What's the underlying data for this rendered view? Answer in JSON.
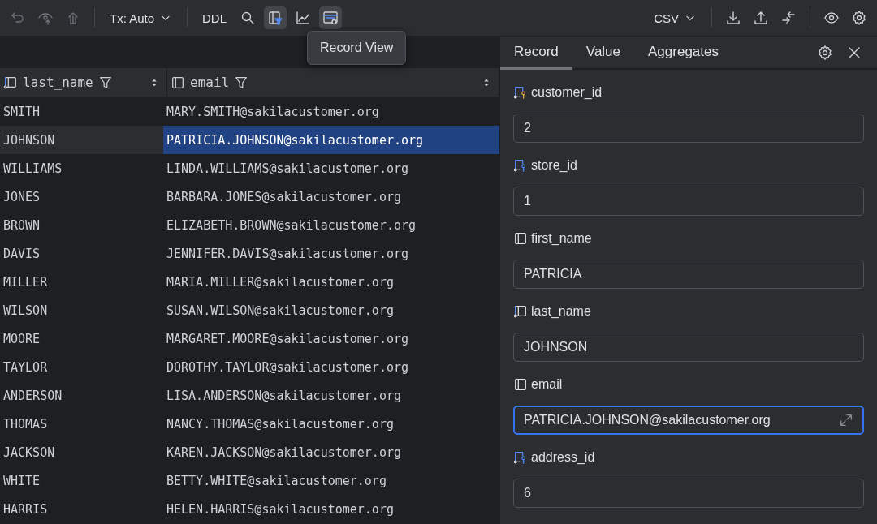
{
  "toolbar": {
    "left": [
      {
        "kind": "undo",
        "disabled": true,
        "toggled": false
      },
      {
        "kind": "eye-up",
        "disabled": true,
        "toggled": false
      },
      {
        "kind": "up",
        "disabled": true,
        "toggled": false
      },
      {
        "kind": "sep"
      },
      {
        "kind": "dropdown",
        "label": "Tx: Auto"
      },
      {
        "kind": "sep"
      },
      {
        "kind": "text",
        "label": "DDL"
      },
      {
        "kind": "search",
        "disabled": false,
        "toggled": false
      },
      {
        "kind": "filter",
        "disabled": false,
        "toggled": true
      },
      {
        "kind": "chart",
        "disabled": false,
        "toggled": false
      },
      {
        "kind": "record",
        "disabled": false,
        "toggled": true
      }
    ],
    "right": [
      {
        "kind": "dropdown",
        "label": "CSV"
      },
      {
        "kind": "sep"
      },
      {
        "kind": "download",
        "disabled": false,
        "toggled": false
      },
      {
        "kind": "upload",
        "disabled": false,
        "toggled": false
      },
      {
        "kind": "compare",
        "disabled": false,
        "toggled": false
      },
      {
        "kind": "sep"
      },
      {
        "kind": "eye",
        "disabled": false,
        "toggled": false
      },
      {
        "kind": "gear",
        "disabled": false,
        "toggled": false
      }
    ],
    "tooltip": "Record View"
  },
  "table": {
    "columns": [
      {
        "name": "last_name",
        "kind": "indexed"
      },
      {
        "name": "email",
        "kind": "column"
      }
    ],
    "rows": [
      {
        "cells": [
          "SMITH",
          "MARY.SMITH@sakilacustomer.org"
        ],
        "selected": false
      },
      {
        "cells": [
          "JOHNSON",
          "PATRICIA.JOHNSON@sakilacustomer.org"
        ],
        "selected": true
      },
      {
        "cells": [
          "WILLIAMS",
          "LINDA.WILLIAMS@sakilacustomer.org"
        ],
        "selected": false
      },
      {
        "cells": [
          "JONES",
          "BARBARA.JONES@sakilacustomer.org"
        ],
        "selected": false
      },
      {
        "cells": [
          "BROWN",
          "ELIZABETH.BROWN@sakilacustomer.org"
        ],
        "selected": false
      },
      {
        "cells": [
          "DAVIS",
          "JENNIFER.DAVIS@sakilacustomer.org"
        ],
        "selected": false
      },
      {
        "cells": [
          "MILLER",
          "MARIA.MILLER@sakilacustomer.org"
        ],
        "selected": false
      },
      {
        "cells": [
          "WILSON",
          "SUSAN.WILSON@sakilacustomer.org"
        ],
        "selected": false
      },
      {
        "cells": [
          "MOORE",
          "MARGARET.MOORE@sakilacustomer.org"
        ],
        "selected": false
      },
      {
        "cells": [
          "TAYLOR",
          "DOROTHY.TAYLOR@sakilacustomer.org"
        ],
        "selected": false
      },
      {
        "cells": [
          "ANDERSON",
          "LISA.ANDERSON@sakilacustomer.org"
        ],
        "selected": false
      },
      {
        "cells": [
          "THOMAS",
          "NANCY.THOMAS@sakilacustomer.org"
        ],
        "selected": false
      },
      {
        "cells": [
          "JACKSON",
          "KAREN.JACKSON@sakilacustomer.org"
        ],
        "selected": false
      },
      {
        "cells": [
          "WHITE",
          "BETTY.WHITE@sakilacustomer.org"
        ],
        "selected": false
      },
      {
        "cells": [
          "HARRIS",
          "HELEN.HARRIS@sakilacustomer.org"
        ],
        "selected": false
      }
    ]
  },
  "record_panel": {
    "tabs": [
      {
        "label": "Record",
        "selected": true
      },
      {
        "label": "Value",
        "selected": false
      },
      {
        "label": "Aggregates",
        "selected": false
      }
    ],
    "fields": [
      {
        "name": "customer_id",
        "kind": "primary_key",
        "value": "2",
        "focused": false
      },
      {
        "name": "store_id",
        "kind": "foreign_key",
        "value": "1",
        "focused": false
      },
      {
        "name": "first_name",
        "kind": "column",
        "value": "PATRICIA",
        "focused": false
      },
      {
        "name": "last_name",
        "kind": "indexed",
        "value": "JOHNSON",
        "focused": false
      },
      {
        "name": "email",
        "kind": "column",
        "value": "PATRICIA.JOHNSON@sakilacustomer.org",
        "focused": true
      },
      {
        "name": "address_id",
        "kind": "foreign_key",
        "value": "6",
        "focused": false
      }
    ]
  }
}
